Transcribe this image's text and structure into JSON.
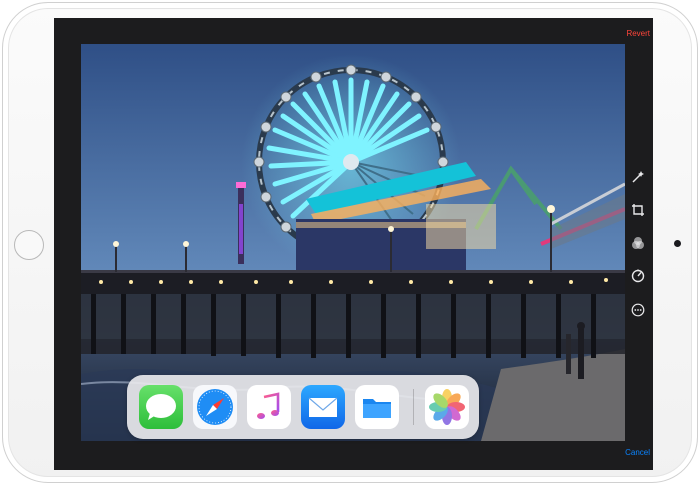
{
  "editor": {
    "revert_label": "Revert",
    "cancel_label": "Cancel",
    "tools": [
      "magic-wand-icon",
      "crop-rotate-icon",
      "filters-icon",
      "adjust-dial-icon",
      "more-options-icon"
    ]
  },
  "dock": {
    "apps": [
      "messages-app-icon",
      "safari-app-icon",
      "music-app-icon",
      "mail-app-icon",
      "files-app-icon"
    ],
    "recent_apps": [
      "photos-app-icon"
    ]
  },
  "colors": {
    "revert": "#ff453a",
    "cancel": "#0a84ff",
    "screen_background": "#1c1c1e"
  }
}
